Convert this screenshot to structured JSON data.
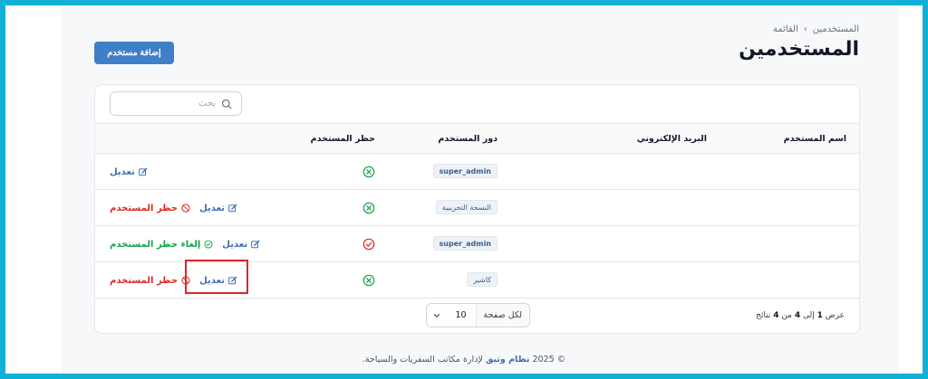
{
  "breadcrumb": {
    "parent": "المستخدمين",
    "separator": "›",
    "current": "القائمة"
  },
  "page_title": "المستخدمين",
  "add_button": "إضافة مستخدم",
  "search": {
    "placeholder": "بحث"
  },
  "table": {
    "headers": {
      "username": "اسم المستخدم",
      "email": "البريد الإلكتروني",
      "role": "دور المستخدم",
      "ban": "حظر المستخدم"
    },
    "rows": [
      {
        "username": "",
        "email": "",
        "role": "super_admin",
        "banned": false,
        "actions": {
          "edit": "تعديل"
        }
      },
      {
        "username": "",
        "email": "",
        "role": "النسخة التجريبية",
        "banned": false,
        "actions": {
          "edit": "تعديل",
          "ban": "حظر المستخدم"
        }
      },
      {
        "username": "",
        "email": "",
        "role": "super_admin",
        "banned": true,
        "actions": {
          "edit": "تعديل",
          "unban": "إلغاء حظر المستخدم"
        }
      },
      {
        "username": "",
        "email": "",
        "role": "كاشير",
        "banned": false,
        "actions": {
          "edit": "تعديل",
          "ban": "حظر المستخدم"
        }
      }
    ]
  },
  "pagination": {
    "per_page_label": "لكل صفحة",
    "per_page_value": "10"
  },
  "summary": {
    "prefix": "عرض",
    "from": "1",
    "mid1": "إلى",
    "to": "4",
    "mid2": "من",
    "total": "4",
    "suffix": "نتائج"
  },
  "footer": {
    "prefix": "© 2025",
    "brand": "نظام وثيق",
    "suffix": "لإدارة مكاتب السفريات والسياحة."
  },
  "colors": {
    "accent": "#3f7fc9",
    "danger": "#d92d20",
    "success": "#16a34a",
    "frame": "#12b0d6"
  }
}
